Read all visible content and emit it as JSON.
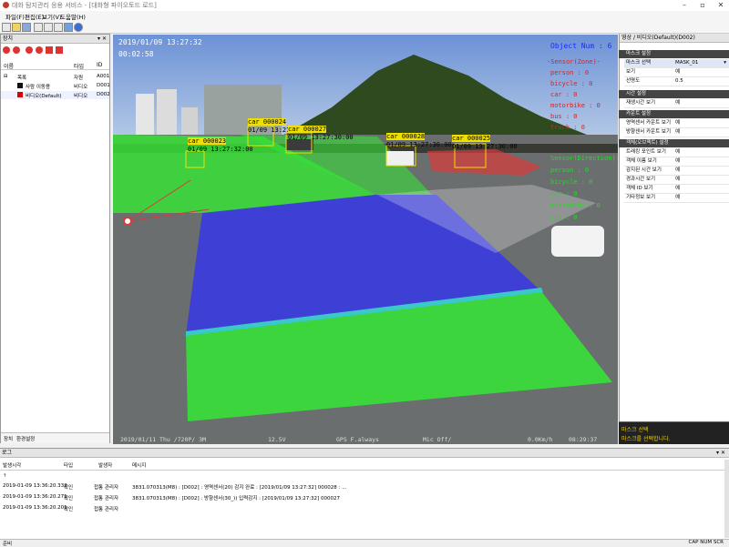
{
  "window": {
    "title": "대화 탐지관리 응용 서비스 - [대화형 파이오토드 로드]",
    "controls": [
      "–",
      "▫",
      "✕"
    ]
  },
  "menu": [
    "파일(F)",
    "편집(E)",
    "보기(V)",
    "도움말(H)"
  ],
  "left_panel": {
    "header": "장치",
    "columns": [
      "이름",
      "타입",
      "ID"
    ],
    "rows": [
      {
        "name": "목록",
        "type": "자원",
        "id": "A001"
      },
      {
        "name": "사람 이동용",
        "type": "비디오",
        "id": "D001"
      },
      {
        "name": "비디오(Default)",
        "type": "비디오",
        "id": "D002"
      }
    ],
    "tabs": [
      "장치",
      "환경설정"
    ]
  },
  "video": {
    "timestamp": "2019/01/09 13:27:32",
    "elapsed": "00:02:58",
    "object_num_label": "Object Num : 6",
    "sensor_title": "-Sensor(Zone)-",
    "sensor_items": [
      "person : 0",
      "bicycle : 0",
      "car : 0",
      "motorbike : 0",
      "bus : 0",
      "truck : 0"
    ],
    "direction_title": "Sensor(Direction)-",
    "direction_items": [
      "person : 0",
      "bicycle : 0",
      "car : 0",
      "motorbike : 0",
      "bus : 0"
    ],
    "car_labels": [
      {
        "label": "car 000023",
        "time": "01/09 13:27:32:00"
      },
      {
        "label": "car 000024",
        "time": "01/09 13:27:30:00"
      },
      {
        "label": "car 000027",
        "time": "01/09 13:27:30:00"
      },
      {
        "label": "car 000028",
        "time": "01/09 13:27:30:00"
      },
      {
        "label": "car 000025",
        "time": "01/09 13:27:30:00"
      }
    ],
    "bottom_osd": [
      "2019/01/11 Thu   /720P/ 3M",
      "12.5V",
      "GPS F.always",
      "Mic Off/",
      "0.0Km/h",
      "08:29:37"
    ],
    "colors": {
      "green": "#3ad63a",
      "blue": "#3a3adf",
      "red": "#d83a3a",
      "cyan": "#3ac8c8"
    }
  },
  "right_panel": {
    "header": "영상 / 비디오(Default)(D002)",
    "sections": [
      {
        "title": "마스크 설정",
        "rows": [
          {
            "key": "마스크 선택",
            "value": "MASK_01"
          },
          {
            "key": "보기",
            "value": "예"
          },
          {
            "key": "선명도",
            "value": "0.5"
          }
        ]
      },
      {
        "title": "시간 설정",
        "rows": [
          {
            "key": "재생시간 보기",
            "value": "예"
          }
        ]
      },
      {
        "title": "카운트 설정",
        "rows": [
          {
            "key": "영역센서 카운트 보기",
            "value": "예"
          },
          {
            "key": "방향센서 카운트 보기",
            "value": "예"
          }
        ]
      },
      {
        "title": "객체(오브젝트) 설정",
        "rows": [
          {
            "key": "트래킹 포인트 보기",
            "value": "예"
          },
          {
            "key": "객체 이름 보기",
            "value": "예"
          },
          {
            "key": "감지된 시간 보기",
            "value": "예"
          },
          {
            "key": "경과시간 보기",
            "value": "예"
          },
          {
            "key": "객체 ID 보기",
            "value": "예"
          },
          {
            "key": "기타정보 보기",
            "value": "예"
          }
        ]
      }
    ],
    "help_title": "마스크 선택",
    "help_text": "마스크를 선택합니다."
  },
  "log": {
    "header": "로그",
    "columns": [
      "발생시각",
      "타입",
      "발생자",
      "메시지"
    ],
    "rows": [
      {
        "time": "2019-01-09 13:36:20.332",
        "type": "확인",
        "source": "접통 관리자",
        "message": "3831.070313(M8) : [D002] : 영역센서(20) 감지 완료 : [2019/01/09 13:27:32] 000028 : ..."
      },
      {
        "time": "2019-01-09 13:36:20.271",
        "type": "확인",
        "source": "접통 관리자",
        "message": "3831.070313(M8) : [D002] : 방향센서(30_)) 입력감지 : [2019/01/09 13:27:32] 000027"
      },
      {
        "time": "2019-01-09 13:36:20.201",
        "type": "확인",
        "source": "접통 관리자",
        "message": ""
      }
    ]
  },
  "status": {
    "left": "준비",
    "right": "CAP  NUM  SCR"
  }
}
